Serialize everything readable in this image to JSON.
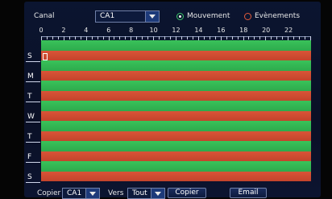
{
  "header": {
    "canal_label": "Canal",
    "channel_value": "CA1",
    "mode_options": [
      {
        "label": "Mouvement",
        "selected": true,
        "color": "#3cc46a"
      },
      {
        "label": "Evènements",
        "selected": false,
        "color": "#e25a3a"
      }
    ]
  },
  "timeline": {
    "hours": [
      "0",
      "2",
      "4",
      "6",
      "8",
      "10",
      "12",
      "14",
      "16",
      "18",
      "20",
      "22"
    ]
  },
  "schedule": {
    "days": [
      "S",
      "M",
      "T",
      "W",
      "T",
      "F",
      "S"
    ],
    "colors": {
      "movement": "#2fb550",
      "events": "#cf4b30"
    }
  },
  "footer": {
    "copy_label": "Copier",
    "copy_from_value": "CA1",
    "to_label": "Vers",
    "copy_to_value": "Tout",
    "copy_button": "Copier",
    "email_button": "Email"
  }
}
